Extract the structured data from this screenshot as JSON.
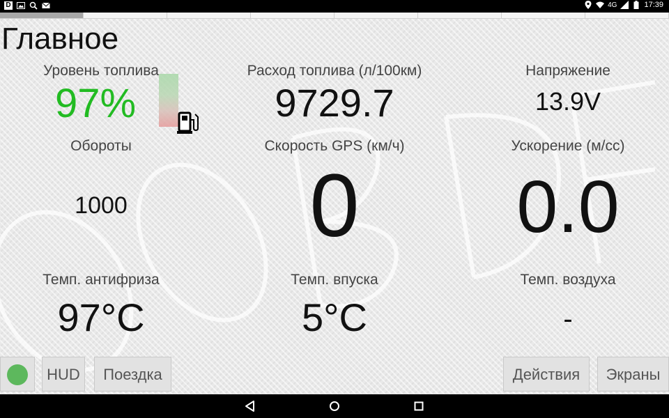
{
  "status_bar": {
    "time": "17:39",
    "network": "4G",
    "left_icons": [
      "d-app-icon",
      "image-icon",
      "search-icon",
      "mail-icon"
    ],
    "right_icons": [
      "location-icon",
      "wifi-icon",
      "signal-icon",
      "battery-icon"
    ]
  },
  "page": {
    "title": "Главное",
    "pager_segments": 8,
    "active_segment": 0
  },
  "gauges": {
    "fuel_level": {
      "label": "Уровень топлива",
      "value": "97%",
      "color": "#22bb22"
    },
    "fuel_consumption": {
      "label": "Расход топлива (л/100км)",
      "value": "9729.7"
    },
    "voltage": {
      "label": "Напряжение",
      "value": "13.9V"
    },
    "rpm": {
      "label": "Обороты",
      "value": "1000"
    },
    "gps_speed": {
      "label": "Скорость GPS (км/ч)",
      "value": "0"
    },
    "acceleration": {
      "label": "Ускорение (м/сс)",
      "value": "0.0"
    },
    "coolant_temp": {
      "label": "Темп. антифриза",
      "value": "97°C"
    },
    "intake_temp": {
      "label": "Темп. впуска",
      "value": "5°C"
    },
    "air_temp": {
      "label": "Темп. воздуха",
      "value": "-"
    }
  },
  "buttons": {
    "status_indicator": {
      "color": "#5db85d"
    },
    "hud": "HUD",
    "trip": "Поездка",
    "actions": "Действия",
    "screens": "Экраны"
  },
  "navbar": {
    "icons": [
      "back-icon",
      "home-icon",
      "recents-icon"
    ]
  }
}
